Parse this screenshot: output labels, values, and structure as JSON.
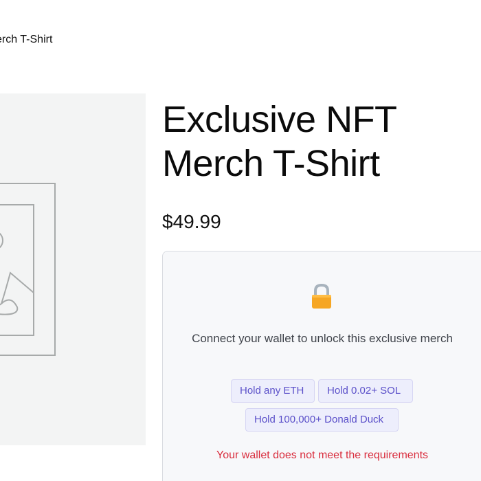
{
  "breadcrumb": {
    "current": "erch T-Shirt"
  },
  "product": {
    "title": "Exclusive NFT Merch T-Shirt",
    "price": "$49.99",
    "image": {
      "icon": "product-placeholder-image-icon"
    }
  },
  "gate": {
    "lock_icon": "lock-icon",
    "message": "Connect your wallet to unlock this exclusive merch",
    "requirements": [
      {
        "label": "Hold any ETH"
      },
      {
        "label": "Hold 0.02+ SOL"
      },
      {
        "label": "Hold 100,000+ Donald Duck"
      }
    ],
    "error": "Your wallet does not meet the requirements"
  },
  "colors": {
    "image_bg": "#f3f4f4",
    "card_bg": "#f7f8fa",
    "card_border": "#d9dce1",
    "badge_bg": "#edeefc",
    "badge_text": "#5a4fc9",
    "error_text": "#d92d3d",
    "lock_body": "#f6a623"
  }
}
